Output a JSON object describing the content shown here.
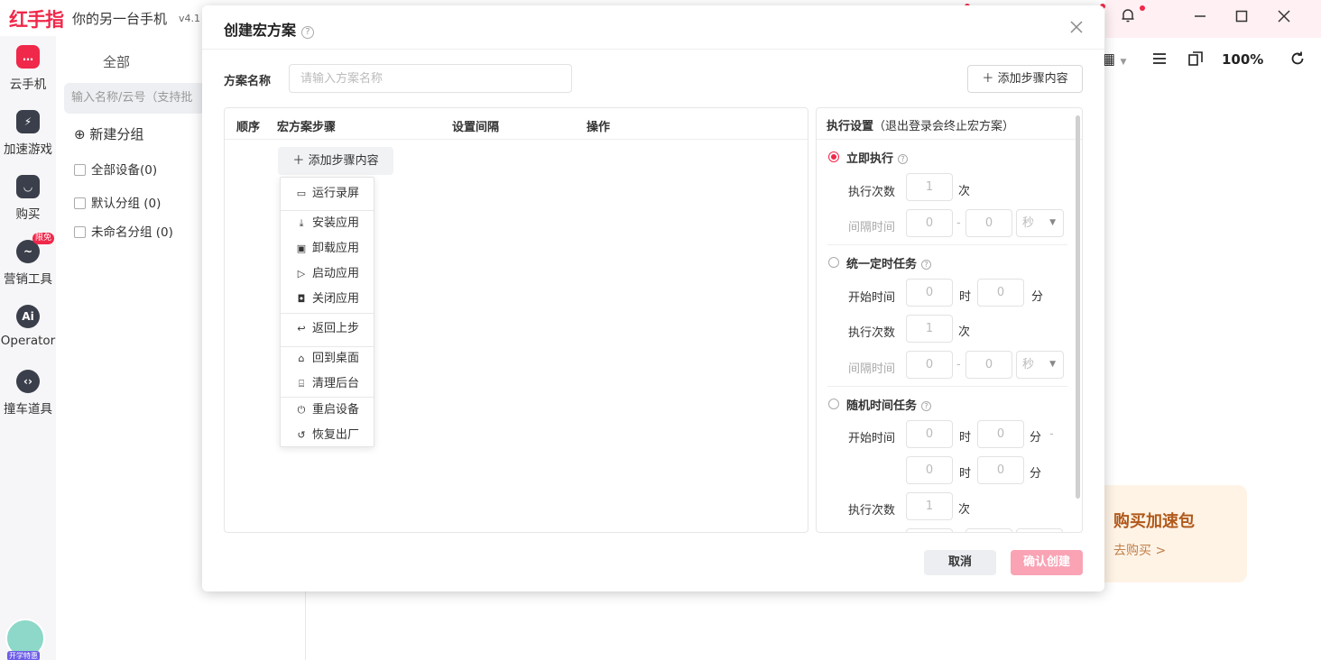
{
  "app": {
    "logo": "红手指",
    "title": "你的另一台手机",
    "version": "v4.1"
  },
  "window": {
    "zoom": "100%"
  },
  "sidebar": {
    "items": [
      {
        "label": "云手机",
        "icon": "phone-icon"
      },
      {
        "label": "加速游戏",
        "icon": "lightning-icon"
      },
      {
        "label": "购买",
        "icon": "bag-icon"
      },
      {
        "label": "营销工具",
        "icon": "chart-icon",
        "badge": "限免"
      },
      {
        "label": "Operator",
        "icon": "ai-icon",
        "icon_text": "Ai"
      },
      {
        "label": "撞车道具",
        "icon": "tool-icon"
      }
    ],
    "avatar_tag": "开学特惠"
  },
  "groups": {
    "tab": "全部",
    "search_placeholder": "输入名称/云号（支持批",
    "new_group": "新建分组",
    "rows": [
      "全部设备(0)",
      "默认分组 (0)",
      "未命名分组 (0)"
    ]
  },
  "promo": {
    "title": "购买加速包",
    "link": "去购买 >"
  },
  "modal": {
    "title": "创建宏方案",
    "name_label": "方案名称",
    "name_placeholder": "请输入方案名称",
    "add_step": "添加步骤内容",
    "columns": [
      "顺序",
      "宏方案步骤",
      "设置间隔",
      "操作"
    ],
    "menu": [
      "运行录屏",
      "安装应用",
      "卸载应用",
      "启动应用",
      "关闭应用",
      "返回上步",
      "回到桌面",
      "清理后台",
      "重启设备",
      "恢复出厂"
    ],
    "exec": {
      "title": "执行设置",
      "note": "（退出登录会终止宏方案）",
      "immediate": {
        "label": "立即执行",
        "count_label": "执行次数",
        "count": "1",
        "count_unit": "次",
        "interval_label": "间隔时间",
        "interval_from": "0",
        "dash": "-",
        "interval_to": "0",
        "interval_unit": "秒"
      },
      "scheduled": {
        "label": "统一定时任务",
        "start_label": "开始时间",
        "hour": "0",
        "hour_unit": "时",
        "minute": "0",
        "minute_unit": "分",
        "count_label": "执行次数",
        "count": "1",
        "count_unit": "次",
        "interval_label": "间隔时间",
        "interval_from": "0",
        "dash": "-",
        "interval_to": "0",
        "interval_unit": "秒"
      },
      "random": {
        "label": "随机时间任务",
        "start_label": "开始时间",
        "hour1": "0",
        "hour_unit": "时",
        "minute1": "0",
        "minute_unit": "分",
        "dash": "-",
        "hour2": "0",
        "minute2": "0",
        "count_label": "执行次数",
        "count": "1",
        "count_unit": "次"
      }
    },
    "cancel": "取消",
    "confirm": "确认创建"
  }
}
